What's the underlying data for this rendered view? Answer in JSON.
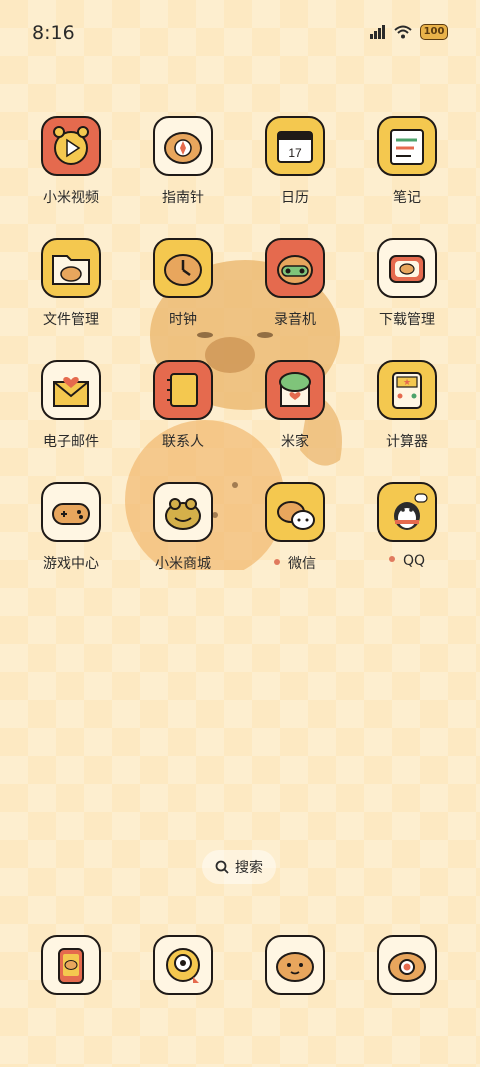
{
  "status_bar": {
    "time": "8:16",
    "battery": "100"
  },
  "apps": [
    {
      "label": "小米视频",
      "icon": "video-play-icon",
      "color": "#e56a4e"
    },
    {
      "label": "指南针",
      "icon": "compass-icon",
      "color": "#fff6e3"
    },
    {
      "label": "日历",
      "icon": "calendar-icon",
      "color": "#f4c84f",
      "day": "17"
    },
    {
      "label": "笔记",
      "icon": "notes-icon",
      "color": "#f4c84f"
    },
    {
      "label": "文件管理",
      "icon": "folder-icon",
      "color": "#f4c84f"
    },
    {
      "label": "时钟",
      "icon": "clock-icon",
      "color": "#f4c84f"
    },
    {
      "label": "录音机",
      "icon": "recorder-icon",
      "color": "#e56a4e"
    },
    {
      "label": "下载管理",
      "icon": "download-icon",
      "color": "#fff6e3"
    },
    {
      "label": "电子邮件",
      "icon": "mail-icon",
      "color": "#fff6e3"
    },
    {
      "label": "联系人",
      "icon": "contacts-icon",
      "color": "#e56a4e"
    },
    {
      "label": "米家",
      "icon": "home-icon",
      "color": "#e56a4e"
    },
    {
      "label": "计算器",
      "icon": "calculator-icon",
      "color": "#f4c84f"
    },
    {
      "label": "游戏中心",
      "icon": "gamepad-icon",
      "color": "#fff6e3"
    },
    {
      "label": "小米商城",
      "icon": "frog-icon",
      "color": "#fff6e3"
    },
    {
      "label": "微信",
      "icon": "wechat-icon",
      "color": "#f4c84f",
      "notify": true
    },
    {
      "label": "QQ",
      "icon": "penguin-icon",
      "color": "#f4c84f",
      "notify": true
    }
  ],
  "search": {
    "label": "搜索"
  },
  "dock": [
    {
      "icon": "phone-icon",
      "color": "#fff6e3"
    },
    {
      "icon": "camera-icon",
      "color": "#fff6e3"
    },
    {
      "icon": "messages-icon",
      "color": "#fff6e3"
    },
    {
      "icon": "browser-icon",
      "color": "#fff6e3"
    }
  ]
}
